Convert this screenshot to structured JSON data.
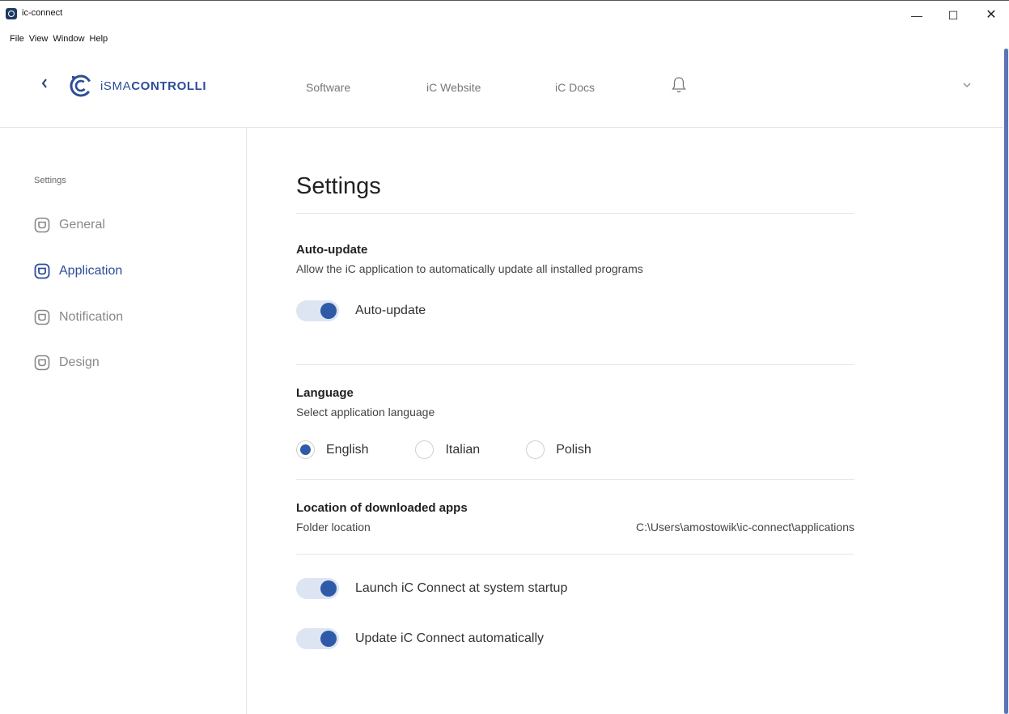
{
  "window": {
    "title": "ic-connect",
    "controls": {
      "minimize": "—",
      "maximize": "☐",
      "close": "✕"
    }
  },
  "menu": [
    "File",
    "View",
    "Window",
    "Help"
  ],
  "header": {
    "back_icon": "chevron-left-icon",
    "logo_light": "iSMA",
    "logo_bold": "CONTROLLI",
    "nav": [
      "Software",
      "iC Website",
      "iC Docs"
    ],
    "bell_icon": "bell-icon",
    "dropdown_icon": "chevron-down-icon"
  },
  "sidebar": {
    "heading": "Settings",
    "items": [
      {
        "label": "General",
        "active": false
      },
      {
        "label": "Application",
        "active": true
      },
      {
        "label": "Notification",
        "active": false
      },
      {
        "label": "Design",
        "active": false
      }
    ]
  },
  "main": {
    "title": "Settings",
    "auto_update": {
      "title": "Auto-update",
      "description": "Allow the iC application to automatically update all installed programs",
      "toggle_label": "Auto-update",
      "enabled": true
    },
    "language": {
      "title": "Language",
      "description": "Select application language",
      "options": [
        "English",
        "Italian",
        "Polish"
      ],
      "selected": "English"
    },
    "location": {
      "title": "Location of downloaded apps",
      "label": "Folder location",
      "path": "C:\\Users\\amostowik\\ic-connect\\applications"
    },
    "startup": {
      "label": "Launch iC Connect at system startup",
      "enabled": true
    },
    "self_update": {
      "label": "Update iC Connect automatically",
      "enabled": true
    }
  },
  "colors": {
    "accent": "#2f5aa8",
    "brand": "#2b4d9a",
    "toggle_track": "#dde5f3",
    "muted_text": "#888888"
  }
}
